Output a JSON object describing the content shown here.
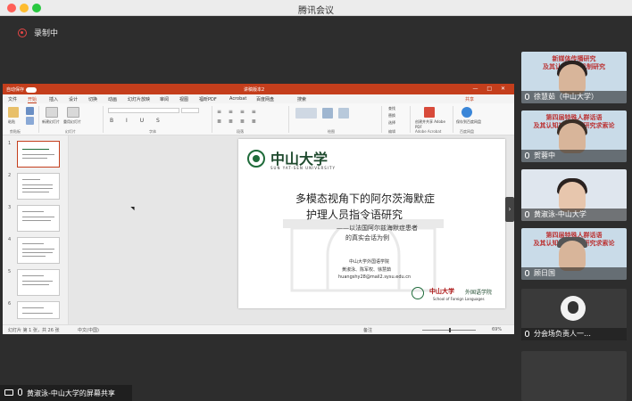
{
  "window": {
    "title": "腾讯会议"
  },
  "recording": {
    "label": "录制中",
    "color": "#e64545"
  },
  "ppt": {
    "autosave": "自动保存",
    "doc_title": "讲稿版本2",
    "window_controls": "— □ ✕",
    "menu": [
      "文件",
      "开始",
      "插入",
      "设计",
      "切换",
      "动画",
      "幻灯片放映",
      "审阅",
      "视图",
      "福昕PDF",
      "Acrobat",
      "百度网盘",
      "搜索"
    ],
    "active_menu": "开始",
    "share_label": "共享",
    "ribbon_groups": [
      "剪贴板",
      "幻灯片",
      "字体",
      "段落",
      "绘图",
      "编辑",
      "Adobe Acrobat",
      "百度网盘"
    ],
    "ribbon_labels": {
      "paste": "粘贴",
      "new_slide": "新建幻灯片",
      "reuse": "重用幻灯片",
      "find": "查找",
      "replace": "替换",
      "select": "选择",
      "create_pdf": "创建并共享 Adobe PDF",
      "save_baidu": "保存到百度网盘"
    },
    "thumb_numbers": [
      "1",
      "2",
      "3",
      "4",
      "5",
      "6"
    ],
    "status": {
      "slide_count": "幻灯片 第 1 张，共 26 张",
      "language": "中文(中国)",
      "notes": "备注",
      "zoom": "69%"
    }
  },
  "slide": {
    "university_cn": "中山大学",
    "university_en": "SUN YAT-SEN UNIVERSITY",
    "title_line1": "多模态视角下的阿尔茨海默症",
    "title_line2": "护理人员指令语研究",
    "subtitle_line1": "——以法国阿尔兹海默症患者",
    "subtitle_line2": "的真实会话为例",
    "school": "中山大学外国语学院",
    "authors": "黄淑泳、陈军权、徐慧茹",
    "email": "huangshy28@mail2.sysu.edu.cn",
    "footer_cn": "中山大学",
    "footer_dept": "外国语学院",
    "footer_en": "School of Foreign Languages"
  },
  "participants": [
    {
      "name": "徐慧茹（中山大学）",
      "banner": "新媒体传播研究\n及其认知神经机制研究"
    },
    {
      "name": "贺蓉中",
      "banner": "第四届特殊人群话语\n及其认知神经机制研究求索论"
    },
    {
      "name": "黄淑泳-中山大学",
      "banner": ""
    },
    {
      "name": "顾日国",
      "banner": "第四届特殊人群话语\n及其认知神经机制研究求索论"
    },
    {
      "name": "分会场负责人一…",
      "banner": ""
    }
  ],
  "bottom": {
    "share_label": "黄淑泳-中山大学的屏幕共享"
  }
}
